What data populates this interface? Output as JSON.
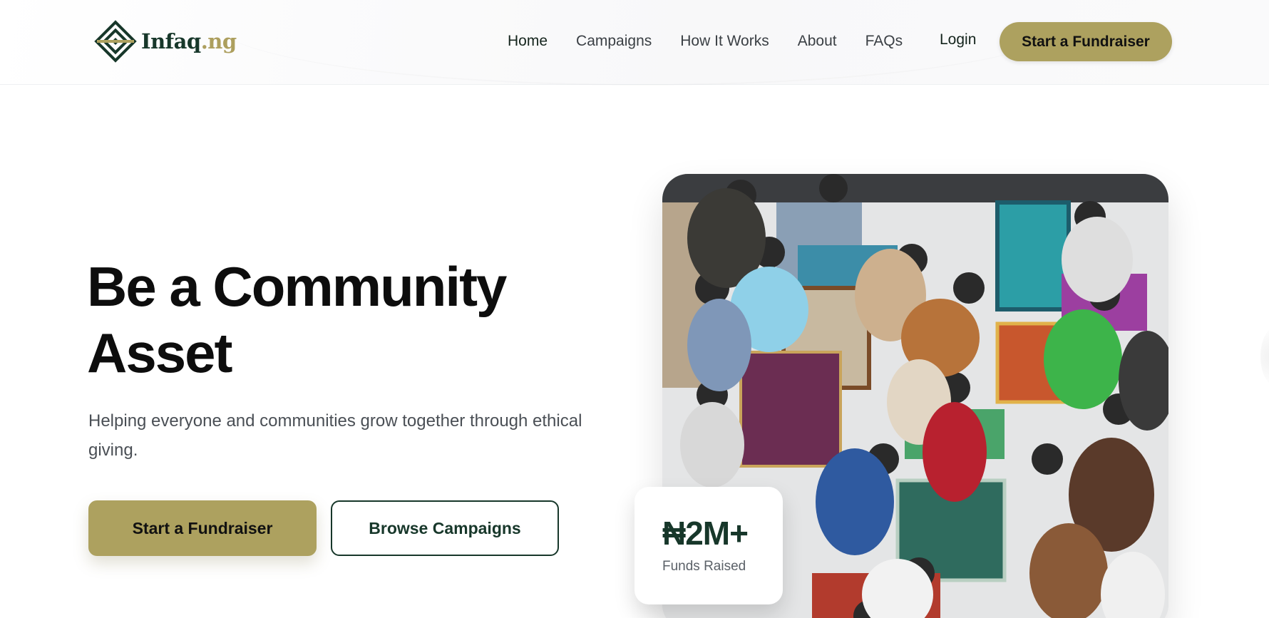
{
  "brand": {
    "name": "Infaq",
    "suffix": ".ng",
    "icon": "geometric-diamond-logo-icon",
    "colors": {
      "dark_green": "#17372a",
      "gold": "#ada15f"
    }
  },
  "nav": {
    "items": [
      "Home",
      "Campaigns",
      "How It Works",
      "About",
      "FAQs"
    ],
    "login": "Login",
    "cta": "Start a Fundraiser"
  },
  "hero": {
    "title": "Be a Community Asset",
    "subtitle": "Helping everyone and communities grow together through ethical giving.",
    "primary_cta": "Start a Fundraiser",
    "secondary_cta": "Browse Campaigns",
    "image_subject": "people-sitting-on-prayer-mats-photo"
  },
  "stat": {
    "value": "₦2M+",
    "label": "Funds Raised"
  }
}
